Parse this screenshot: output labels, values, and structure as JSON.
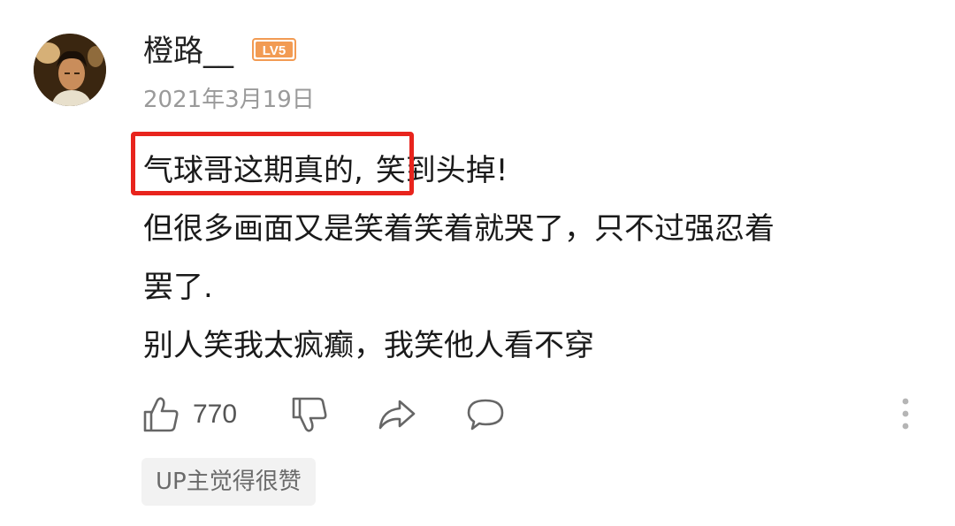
{
  "comment": {
    "author": "橙路__",
    "level_badge": "LV5",
    "date": "2021年3月19日",
    "highlighted_text": "气球哥这期真的,",
    "lines": [
      "笑到头掉!",
      "但很多画面又是笑着笑着就哭了，只不过强忍着",
      "罢了.",
      "别人笑我太疯癫，我笑他人看不穿"
    ],
    "like_count": "770",
    "up_tag": "UP主觉得很赞"
  },
  "icons": {
    "like": "thumbs-up-icon",
    "dislike": "thumbs-down-icon",
    "share": "share-icon",
    "reply": "reply-bubble-icon",
    "more": "more-vertical-icon"
  },
  "colors": {
    "highlight_border": "#e8241d",
    "level_badge": "#f29b53",
    "icon_gray": "#666666"
  }
}
